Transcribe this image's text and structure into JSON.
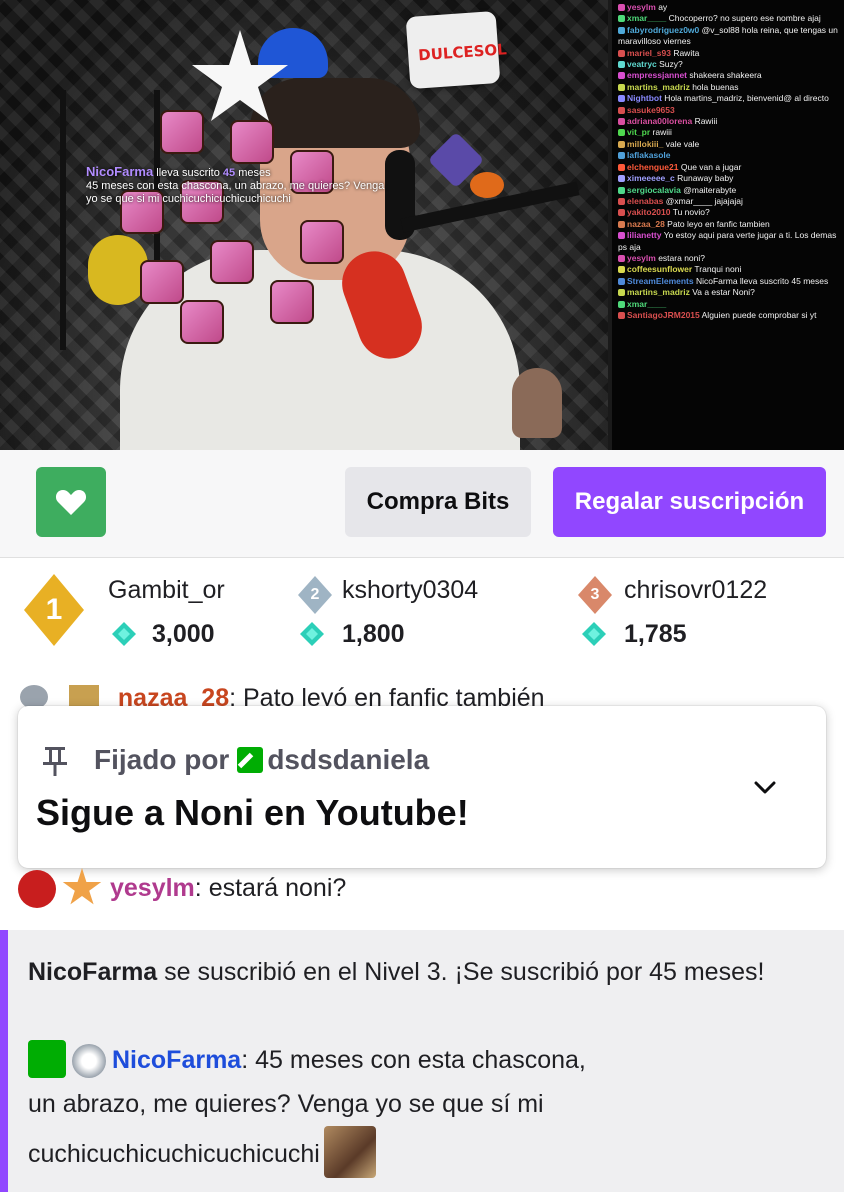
{
  "stream": {
    "pillow_text": "DULCESOL",
    "alert": {
      "name": "NicoFarma",
      "prefix": "lleva suscrito",
      "months": "45",
      "suffix": "meses",
      "text": "45 meses con esta chascona, un abrazo, me quieres? Venga yo se que si mi cuchicuchicuchicuchicuchi"
    },
    "overlay_chat": [
      {
        "user": "yesylm",
        "color": "#d94fb0",
        "text": "ay"
      },
      {
        "user": "xmar____",
        "color": "#4fd97a",
        "text": "Chocoperro? no supero ese nombre ajaj"
      },
      {
        "user": "fabyrodriguez0w0",
        "color": "#4fa9d9",
        "text": "@v_sol88 hola reina, que tengas un maravilloso viernes"
      },
      {
        "user": "mariel_s93",
        "color": "#d94f4f",
        "text": "Rawita"
      },
      {
        "user": "veatryc",
        "color": "#5fd9d0",
        "text": "Suzy?"
      },
      {
        "user": "empressjannet",
        "color": "#d94fd0",
        "text": "shakeera shakeera"
      },
      {
        "user": "martins_madriz",
        "color": "#c8d94f",
        "text": "hola buenas"
      },
      {
        "user": "Nightbot",
        "color": "#8a8aff",
        "text": "Hola martins_madriz, bienvenid@ al directo"
      },
      {
        "user": "sasuke9653",
        "color": "#d94f4f",
        "text": ""
      },
      {
        "user": "adriana00lorena",
        "color": "#d94fa0",
        "text": "Rawiii"
      },
      {
        "user": "vit_pr",
        "color": "#4fd94f",
        "text": "rawiii"
      },
      {
        "user": "millokiii_",
        "color": "#d9a94f",
        "text": "vale vale"
      },
      {
        "user": "laflakasole",
        "color": "#4fa0d9",
        "text": ""
      },
      {
        "user": "elchengue21",
        "color": "#ff5a3a",
        "text": "Que van a jugar"
      },
      {
        "user": "ximeeeee_c",
        "color": "#a0a0ff",
        "text": "Runaway baby"
      },
      {
        "user": "sergiocalavia",
        "color": "#4fd98a",
        "text": "@maiterabyte"
      },
      {
        "user": "elenabas",
        "color": "#d94f4f",
        "text": "@xmar____ jajajajaj"
      },
      {
        "user": "yakito2010",
        "color": "#d94f4f",
        "text": "Tu novio?"
      },
      {
        "user": "nazaa_28",
        "color": "#d97a4f",
        "text": "Pato leyo en fanfic tambien"
      },
      {
        "user": "lilianetty",
        "color": "#d94fd0",
        "text": "Yo estoy aqui para verte jugar a ti. Los demas ps aja"
      },
      {
        "user": "yesylm",
        "color": "#d94fb0",
        "text": "estara noni?"
      },
      {
        "user": "coffeesunflower",
        "color": "#d9d94f",
        "text": "Tranqui noni"
      },
      {
        "user": "StreamElements",
        "color": "#4f8ad9",
        "text": "NicoFarma lleva suscrito 45 meses"
      },
      {
        "user": "martins_madriz",
        "color": "#c8d94f",
        "text": "Va a estar Noni?"
      },
      {
        "user": "xmar____",
        "color": "#4fd97a",
        "text": ""
      },
      {
        "user": "SantiagoJRM2015",
        "color": "#d94f4f",
        "text": "Alguien puede comprobar si yt"
      }
    ]
  },
  "actions": {
    "follow_icon": "heart-icon",
    "follow_color": "#3ead5f",
    "bits_label": "Compra Bits",
    "gift_label": "Regalar suscripción",
    "accent": "#9147ff"
  },
  "leaderboard": [
    {
      "rank": "1",
      "name": "Gambit_or",
      "amount": "3,000",
      "badge_color": "#e8b024"
    },
    {
      "rank": "2",
      "name": "kshorty0304",
      "amount": "1,800",
      "badge_color": "#9fb4c4"
    },
    {
      "rank": "3",
      "name": "chrisovr0122",
      "amount": "1,785",
      "badge_color": "#d9886a"
    }
  ],
  "chat": {
    "faded_line": {
      "user": "nazaa_28",
      "text": ": Pato leyó en fanfic también"
    },
    "pinned": {
      "label": "Fijado por",
      "user": "dsdsdaniela",
      "message": "Sigue a Noni en Youtube!"
    },
    "message1": {
      "user": "yesylm",
      "sep": ":",
      "text": " estará noni?"
    },
    "sub_notice": {
      "user": "NicoFarma",
      "text": " se suscribió en el Nivel 3. ¡Se suscribió por 45 meses!",
      "msg_user": "NicoFarma",
      "msg_sep": ":",
      "msg_line1": " 45 meses con esta chascona,",
      "msg_line2": "un abrazo, me quieres? Venga yo se que sí mi",
      "msg_line3": "cuchicuchicuchicuchicuchi"
    }
  }
}
